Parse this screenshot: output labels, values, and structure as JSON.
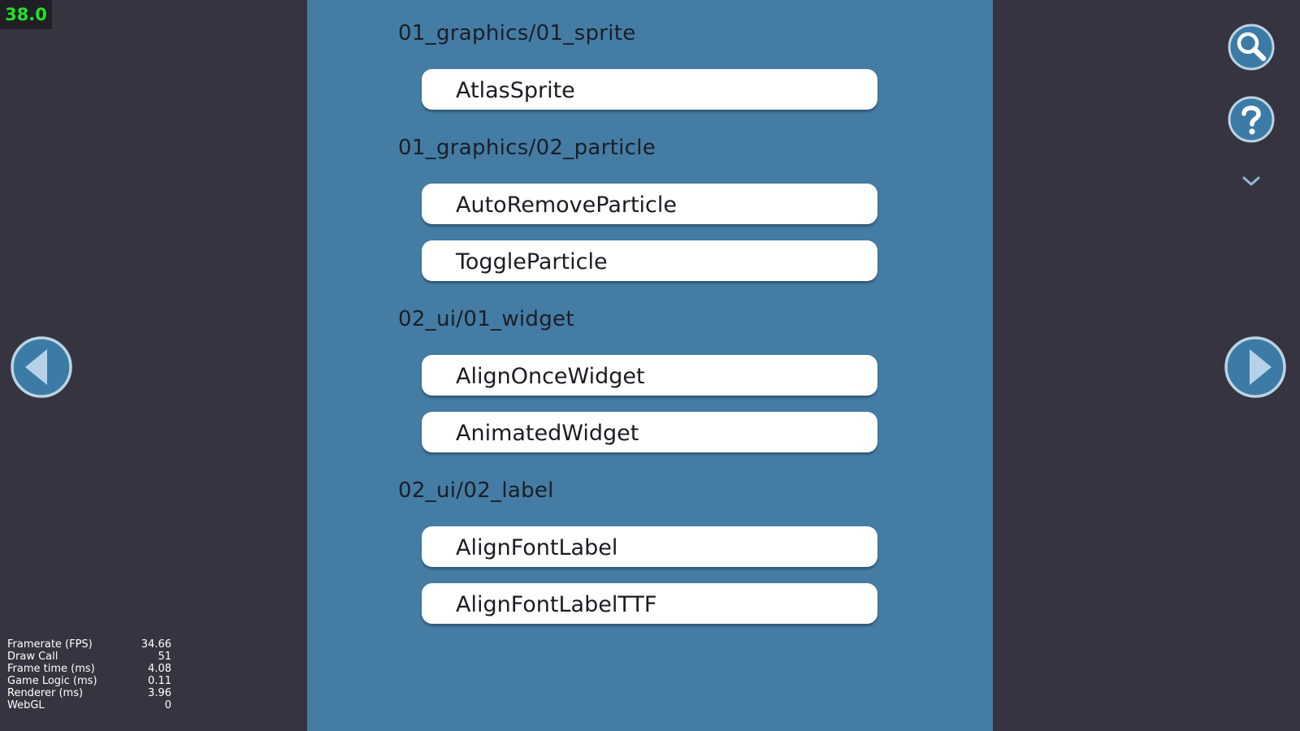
{
  "fps_badge": "38.0",
  "colors": {
    "background": "#353440",
    "panel": "#447ca4",
    "button": "#ffffff",
    "icon_fill": "#3c7ba5",
    "icon_ring": "#bcd3e3",
    "fps_text": "#22e322"
  },
  "sections": [
    {
      "title": "01_graphics/01_sprite",
      "items": [
        "AtlasSprite"
      ]
    },
    {
      "title": "01_graphics/02_particle",
      "items": [
        "AutoRemoveParticle",
        "ToggleParticle"
      ]
    },
    {
      "title": "02_ui/01_widget",
      "items": [
        "AlignOnceWidget",
        "AnimatedWidget"
      ]
    },
    {
      "title": "02_ui/02_label",
      "items": [
        "AlignFontLabel",
        "AlignFontLabelTTF"
      ]
    }
  ],
  "icons": {
    "search": "search-icon",
    "help": "help-icon",
    "collapse": "chevron-down-icon",
    "prev": "prev-arrow-icon",
    "next": "next-arrow-icon"
  },
  "stats": [
    {
      "label": "Framerate (FPS)",
      "value": "34.66"
    },
    {
      "label": "Draw Call",
      "value": "51"
    },
    {
      "label": "Frame time (ms)",
      "value": "4.08"
    },
    {
      "label": "Game Logic (ms)",
      "value": "0.11"
    },
    {
      "label": "Renderer (ms)",
      "value": "3.96"
    },
    {
      "label": "WebGL",
      "value": "0"
    }
  ]
}
